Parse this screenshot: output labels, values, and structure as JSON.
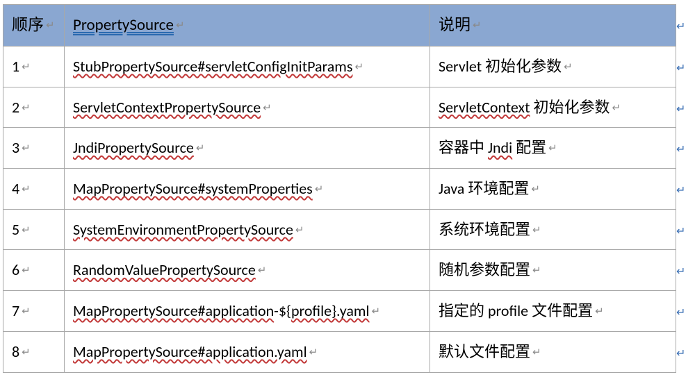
{
  "header": {
    "seq": "顺序",
    "prop": "PropertySource",
    "desc": "说明"
  },
  "paragraph_mark": "↵",
  "row_end_mark": "↵",
  "rows": [
    {
      "seq": "1",
      "prop_parts": [
        {
          "text": "StubPropertySource#servletConfigInitParams",
          "class": "spellerr"
        }
      ],
      "desc_parts": [
        {
          "text": "Servlet 初始化参数",
          "class": ""
        }
      ]
    },
    {
      "seq": "2",
      "prop_parts": [
        {
          "text": "ServletContextPropertySource",
          "class": "spellerr"
        }
      ],
      "desc_parts": [
        {
          "text": "ServletContext",
          "class": "spellerr"
        },
        {
          "text": " 初始化参数",
          "class": ""
        }
      ]
    },
    {
      "seq": "3",
      "prop_parts": [
        {
          "text": "JndiPropertySource",
          "class": "spellerr"
        }
      ],
      "desc_parts": [
        {
          "text": "容器中 ",
          "class": ""
        },
        {
          "text": "Jndi",
          "class": "spellerr"
        },
        {
          "text": " 配置",
          "class": ""
        }
      ]
    },
    {
      "seq": "4",
      "prop_parts": [
        {
          "text": "MapPropertySource#systemProperties",
          "class": "spellerr"
        }
      ],
      "desc_parts": [
        {
          "text": "Java 环境配置",
          "class": ""
        }
      ]
    },
    {
      "seq": "5",
      "prop_parts": [
        {
          "text": "SystemEnvironmentPropertySource",
          "class": "spellerr"
        }
      ],
      "desc_parts": [
        {
          "text": "系统环境配置",
          "class": ""
        }
      ]
    },
    {
      "seq": "6",
      "prop_parts": [
        {
          "text": "RandomValuePropertySource",
          "class": "spellerr"
        }
      ],
      "desc_parts": [
        {
          "text": "随机参数配置",
          "class": ""
        }
      ]
    },
    {
      "seq": "7",
      "prop_parts": [
        {
          "text": "MapPropertySource#application",
          "class": "spellerr"
        },
        {
          "text": "-${",
          "class": ""
        },
        {
          "text": "profile}.yaml",
          "class": "spellerr"
        }
      ],
      "desc_parts": [
        {
          "text": "指定的 profile 文件配置",
          "class": ""
        }
      ]
    },
    {
      "seq": "8",
      "prop_parts": [
        {
          "text": "MapPropertySource#application.yaml",
          "class": "spellerr"
        }
      ],
      "desc_parts": [
        {
          "text": "默认文件配置",
          "class": ""
        }
      ]
    }
  ]
}
